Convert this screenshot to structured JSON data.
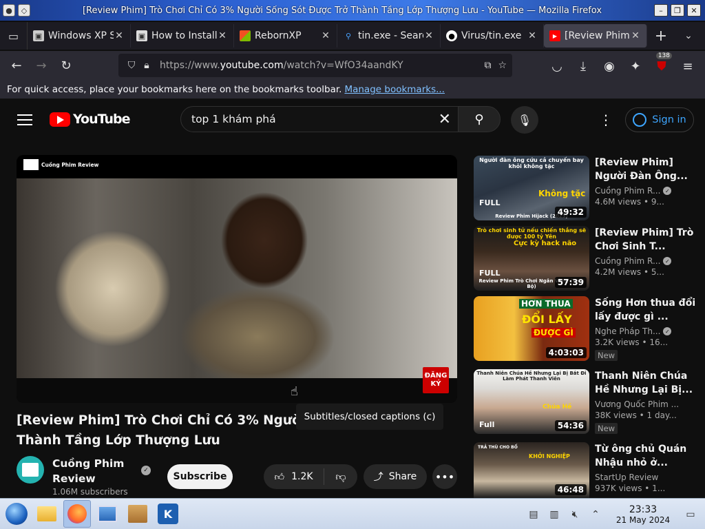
{
  "window": {
    "title": "[Review Phim] Trò Chơi Chỉ Có 3% Người Sống Sót Được Trở Thành Tầng Lớp Thượng Lưu - YouTube — Mozilla Firefox"
  },
  "tabs": [
    {
      "label": "Windows XP S",
      "favicon": "windows-icon",
      "active": false
    },
    {
      "label": "How to Install",
      "favicon": "page-icon",
      "active": false
    },
    {
      "label": "RebornXP",
      "favicon": "windows-flag-icon",
      "active": false
    },
    {
      "label": "tin.exe - Searc",
      "favicon": "search-icon",
      "active": false
    },
    {
      "label": "Virus/tin.exe",
      "favicon": "github-icon",
      "active": false
    },
    {
      "label": "[Review Phim",
      "favicon": "youtube-icon",
      "active": true
    }
  ],
  "url": {
    "prefix": "https://www.",
    "domain": "youtube.com",
    "path": "/watch?v=WfO34aandKY"
  },
  "extension_badge": "138",
  "bookmarks_bar": {
    "text": "For quick access, place your bookmarks here on the bookmarks toolbar.",
    "link": "Manage bookmarks..."
  },
  "youtube": {
    "logo_text": "YouTube",
    "search_value": "top 1 khám phá",
    "signin_label": "Sign in"
  },
  "player": {
    "watermark": "Cuồng Phim Review",
    "subscribe_stamp": "ĐĂNG KÝ",
    "tooltip": "Subtitles/closed captions (c)"
  },
  "video": {
    "title": "[Review Phim] Trò Chơi Chỉ Có 3% Người Sống Sót Được Trở Thành Tầng Lớp Thượng Lưu",
    "channel_name": "Cuồng Phim Review",
    "subscribers": "1.06M subscribers",
    "subscribe_label": "Subscribe",
    "likes": "1.2K",
    "share_label": "Share"
  },
  "recommendations": [
    {
      "title": "[Review Phim] Người Đàn Ông...",
      "channel": "Cuồng Phim R...",
      "verified": true,
      "meta": "4.6M views • 9...",
      "duration": "49:32",
      "is_new": false
    },
    {
      "title": "[Review Phim] Trò Chơi Sinh T...",
      "channel": "Cuồng Phim R...",
      "verified": true,
      "meta": "4.2M views • 5...",
      "duration": "57:39",
      "is_new": false
    },
    {
      "title": "Sống Hơn thua đổi lấy được gì ...",
      "channel": "Nghe Pháp Th...",
      "verified": true,
      "meta": "3.2K views • 16...",
      "duration": "4:03:03",
      "is_new": true
    },
    {
      "title": "Thanh Niên Chúa Hề Nhưng Lại Bị...",
      "channel": "Vương Quốc Phim ...",
      "verified": false,
      "meta": "38K views • 1 day...",
      "duration": "54:36",
      "is_new": true
    },
    {
      "title": "Từ ông chủ Quán Nhậu nhỏ ở...",
      "channel": "StartUp Review",
      "verified": false,
      "meta": "937K views • 1...",
      "duration": "46:48",
      "is_new": false
    }
  ],
  "thumb_text": {
    "t1_top": "Người đàn ông cứu cả chuyến bay khỏi không tặc",
    "t1_big": "Không tặc",
    "t1_bottom": "Review Phim Hijack (2023)",
    "t2_top": "Trò chơi sinh tử nếu chiến thắng sẽ được 100 tỷ Yên",
    "t2_big": "Cực kỳ hack não",
    "t2_bottom": "Review Phim Trò Chơi Ngân Vàng (Trọn Bộ)",
    "t3_big1": "HƠN THUA",
    "t3_big2": "ĐỔI LẤY",
    "t3_big3": "ĐƯỢC GÌ",
    "t4_top": "Thanh Niên Chúa Hề Nhưng Lại Bị Bắt Đi Làm Phát Thanh Viên",
    "t4_big": "Chúa Hề",
    "t5_top": "TRẢ THÙ CHO BỐ",
    "t5_big": "KHỞI NGHIỆP",
    "full": "FULL",
    "full_small": "Full"
  },
  "taskbar": {
    "time": "23:33",
    "date": "21 May 2024",
    "apps": [
      "start-orb-icon",
      "file-explorer-icon",
      "firefox-icon",
      "control-panel-icon",
      "package-icon",
      "kde-icon"
    ]
  }
}
